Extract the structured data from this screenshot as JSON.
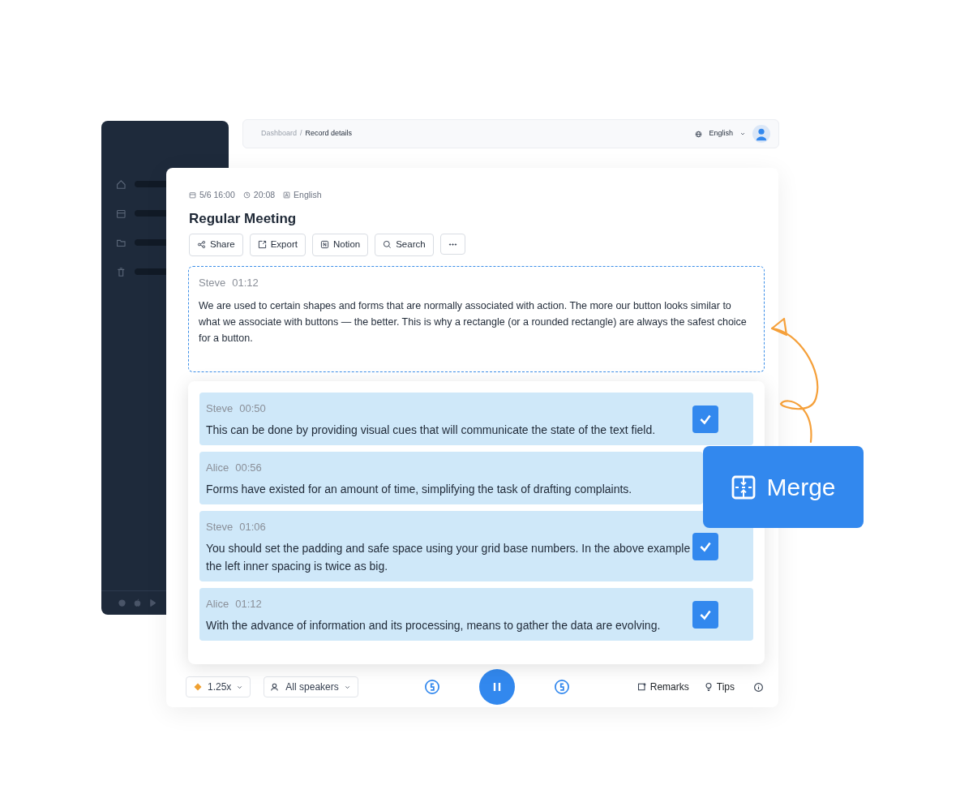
{
  "breadcrumb": [
    {
      "label": "Dashboard",
      "selected": false
    },
    {
      "label": "Record details",
      "selected": true
    }
  ],
  "breadcrumb_separator": "/",
  "header": {
    "language": "English"
  },
  "record": {
    "date": "5/6 16:00",
    "duration": "20:08",
    "language": "English",
    "title": "Regular Meeting",
    "actions": [
      {
        "kind": "share",
        "label": "Share"
      },
      {
        "kind": "export",
        "label": "Export"
      },
      {
        "kind": "notion",
        "label": "Notion"
      },
      {
        "kind": "search",
        "label": "Search"
      },
      {
        "kind": "more"
      }
    ]
  },
  "quote": {
    "speaker": "Steve",
    "time": "01:12",
    "text": "We are used to certain shapes and forms that are normally associated with action. The more our button looks similar to what we associate with buttons — the better. This is why a rectangle (or a rounded rectangle) are always the safest choice for a button."
  },
  "segments": [
    {
      "speaker": "Steve",
      "time": "00:50",
      "text": "This can be done by providing visual cues that will communicate the state of the text field.",
      "checked": true
    },
    {
      "speaker": "Alice",
      "time": "00:56",
      "text": "Forms have existed for an amount of time, simplifying the task of drafting complaints.",
      "checked": false
    },
    {
      "speaker": "Steve",
      "time": "01:06",
      "text": "You should set the padding and safe space using your grid base numbers. In the above example the left inner spacing is twice as big.",
      "checked": true
    },
    {
      "speaker": "Alice",
      "time": "01:12",
      "text": "With the advance of information and its processing, means to gather the data are evolving.",
      "checked": true
    }
  ],
  "player": {
    "speed": "1.25x",
    "speakers": "All speakers",
    "playing": true,
    "remarks": "Remarks",
    "tips": "Tips"
  },
  "merge_button": "Merge"
}
